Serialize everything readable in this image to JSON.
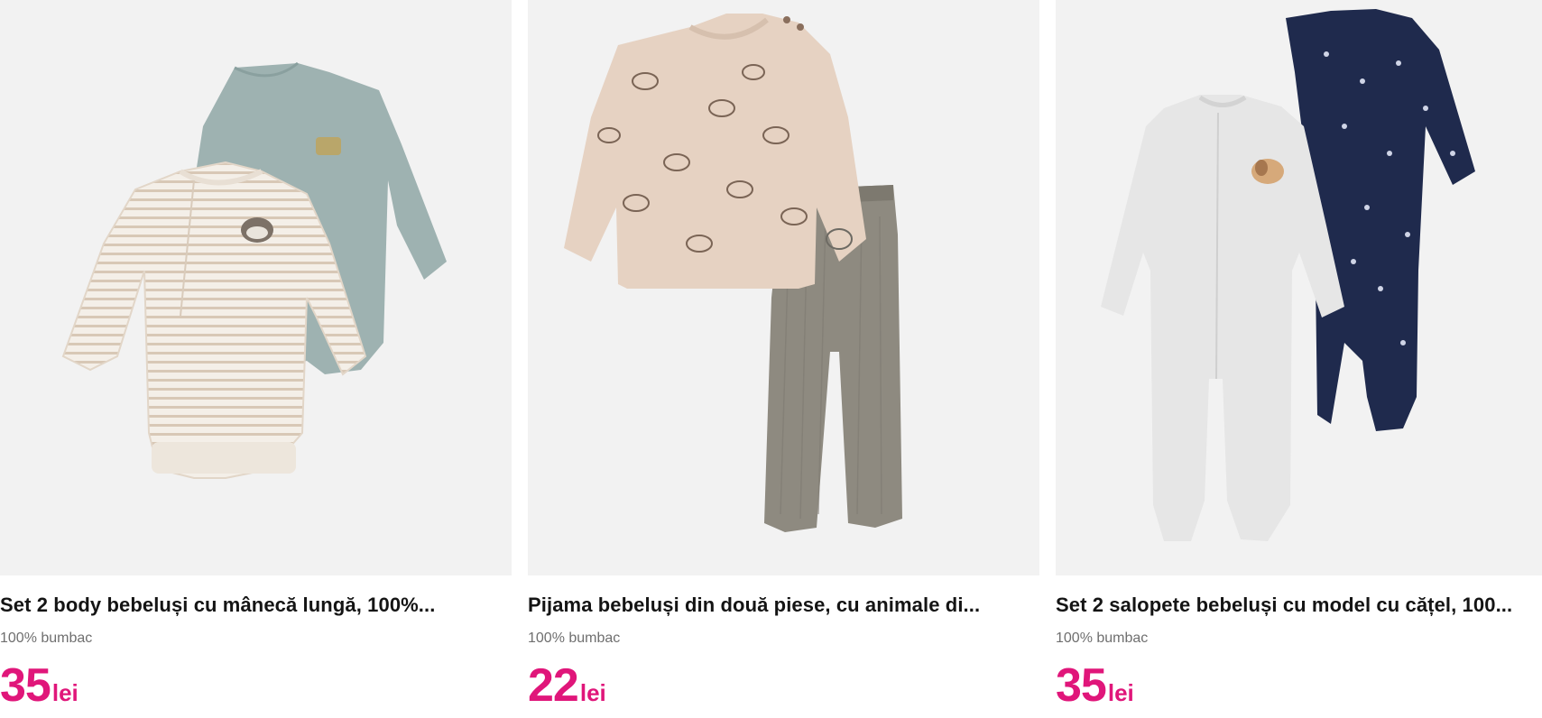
{
  "accent_color": "#e0167a",
  "products": [
    {
      "title": "Set 2 body bebeluși cu mânecă lungă, 100%...",
      "subtitle": "100% bumbac",
      "price": "35",
      "currency": "lei",
      "image_icon": "baby-bodysuit-set-image"
    },
    {
      "title": "Pijama bebeluși din două piese, cu animale di...",
      "subtitle": "100% bumbac",
      "price": "22",
      "currency": "lei",
      "image_icon": "baby-pajama-set-image"
    },
    {
      "title": "Set 2 salopete bebeluși cu model cu cățel, 100...",
      "subtitle": "100% bumbac",
      "price": "35",
      "currency": "lei",
      "image_icon": "baby-sleepsuit-set-image"
    }
  ]
}
